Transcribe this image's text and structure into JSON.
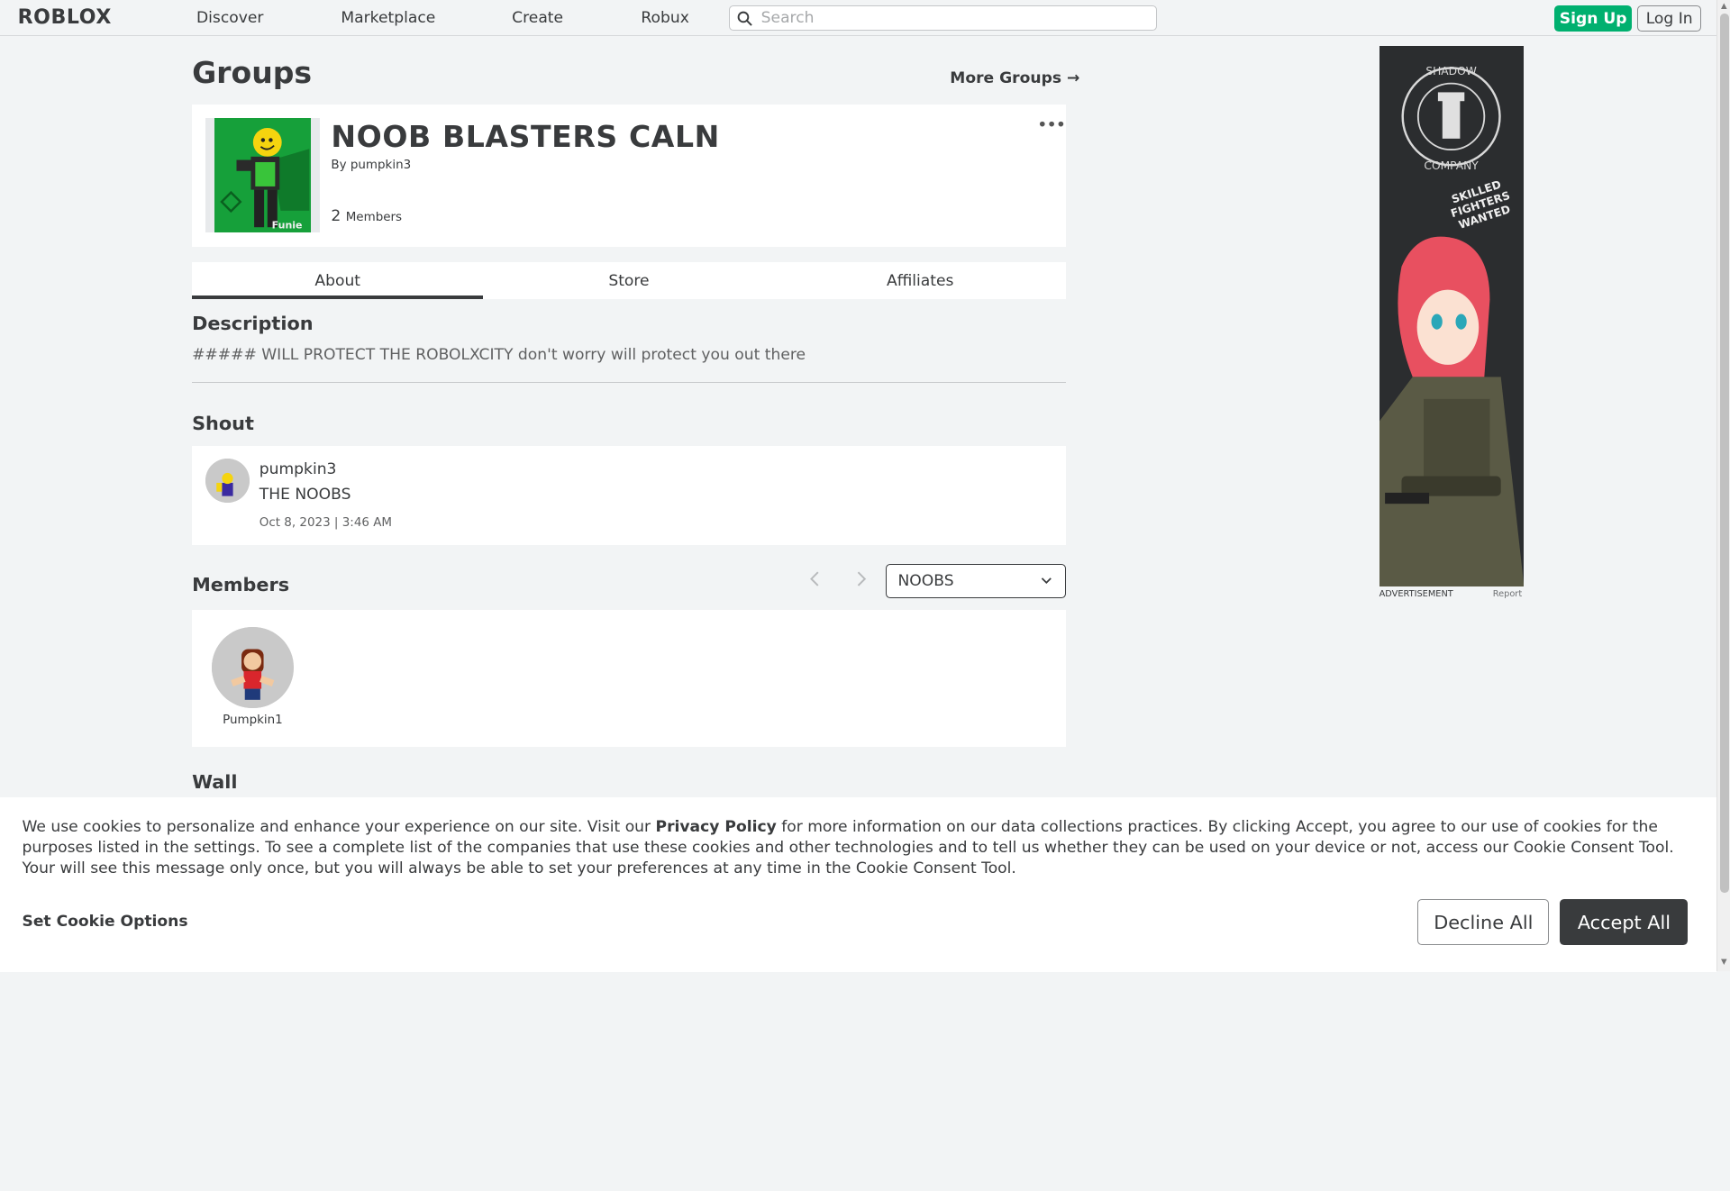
{
  "header": {
    "logo": "RΟBLOX",
    "nav": [
      "Discover",
      "Marketplace",
      "Create",
      "Robux"
    ],
    "search_placeholder": "Search",
    "signup": "Sign Up",
    "login": "Log In"
  },
  "page": {
    "title": "Groups",
    "more_groups": "More Groups →"
  },
  "group": {
    "name": "NOOB BLASTERS CALN",
    "by_prefix": "By",
    "owner": "pumpkin3",
    "member_count": "2",
    "members_label": "Members",
    "emblem_caption": "Funie"
  },
  "tabs": [
    "About",
    "Store",
    "Affiliates"
  ],
  "description": {
    "title": "Description",
    "text": "##### WILL PROTECT THE ROBOLXCITY don't worry will protect you out there"
  },
  "shout": {
    "title": "Shout",
    "user": "pumpkin3",
    "text": "THE NOOBS",
    "date": "Oct 8, 2023 | 3:46 AM"
  },
  "members": {
    "title": "Members",
    "role_selected": "NOOBS",
    "list": [
      {
        "name": "Pumpkin1"
      }
    ]
  },
  "wall": {
    "title": "Wall"
  },
  "ad": {
    "label": "ADVERTISEMENT",
    "report": "Report",
    "brand_top": "SHADOW",
    "brand_bottom": "COMPANY",
    "tagline_1": "SKILLED",
    "tagline_2": "FIGHTERS",
    "tagline_3": "WANTED"
  },
  "cookie": {
    "text_1": "We use cookies to personalize and enhance your experience on our site. Visit our ",
    "privacy_link": "Privacy Policy",
    "text_2": " for more information on our data collections practices. By clicking Accept, you agree to our use of cookies for the purposes listed in the settings. To see a complete list of the companies that use these cookies and other technologies and to tell us whether they can be used on your device or not, access our Cookie Consent Tool. Your will see this message only once, but you will always be able to set your preferences at any time in the Cookie Consent Tool.",
    "set_options": "Set Cookie Options",
    "decline": "Decline All",
    "accept": "Accept All"
  },
  "colors": {
    "signup": "#00b06f",
    "accept": "#393b3d",
    "background": "#f2f4f5"
  }
}
